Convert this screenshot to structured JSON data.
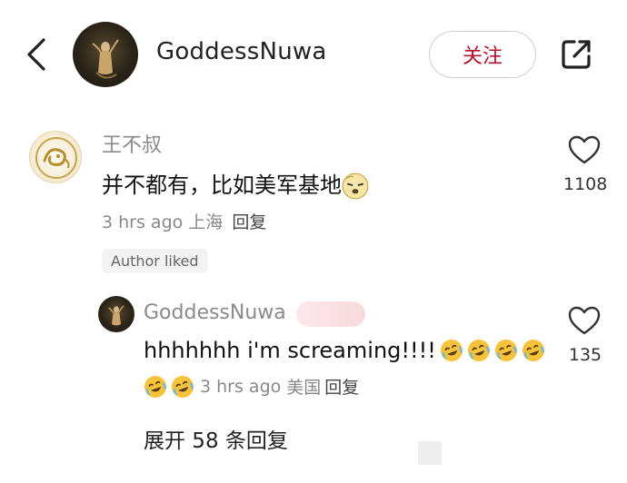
{
  "header": {
    "username": "GoddessNuwa",
    "follow_label": "关注"
  },
  "comments": [
    {
      "username": "王不叔",
      "text": "并不都有，比如美军基地",
      "emoji": "squinting-face-emoji",
      "time": "3 hrs ago",
      "location": "上海",
      "reply_label": "回复",
      "likes": "1108",
      "badge": "Author liked"
    }
  ],
  "reply": {
    "username": "GoddessNuwa",
    "text": "hhhhhhh i'm screaming!!!!",
    "emoji": "rolling-on-floor-laughing-emoji",
    "time": "3 hrs ago",
    "location": "美国",
    "reply_label": "回复",
    "likes": "135"
  },
  "expand_label": "展开 58 条回复",
  "colors": {
    "follow_text": "#b0122e",
    "muted_text": "#888888",
    "primary_text": "#111111"
  }
}
